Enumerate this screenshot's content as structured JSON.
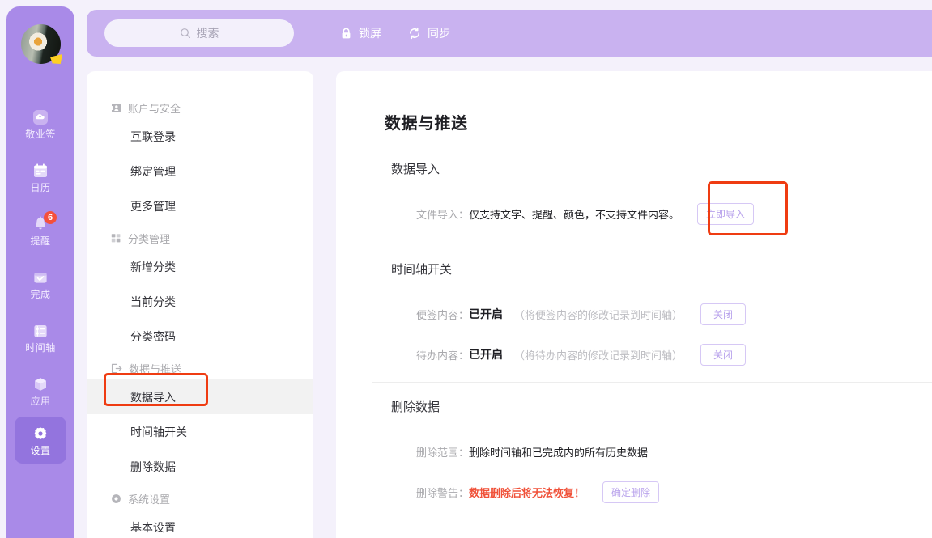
{
  "colors": {
    "rail_bg": "#a98ae8",
    "rail_active": "#9374de",
    "topbar_bg": "#c9b2f0",
    "page_bg": "#f4f1fb",
    "accent_purple": "#b9a3ec",
    "annotation_red": "#ef3c12",
    "danger_red": "#f0523a",
    "badge_red": "#f5503b"
  },
  "rail": {
    "avatar_name": "user-avatar",
    "items": [
      {
        "label": "敬业签",
        "icon": "note-cloud-icon",
        "active": false,
        "badge": ""
      },
      {
        "label": "日历",
        "icon": "calendar-icon",
        "active": false,
        "badge": ""
      },
      {
        "label": "提醒",
        "icon": "bell-icon",
        "active": false,
        "badge": "6"
      },
      {
        "label": "完成",
        "icon": "check-box-icon",
        "active": false,
        "badge": ""
      },
      {
        "label": "时间轴",
        "icon": "timeline-icon",
        "active": false,
        "badge": ""
      },
      {
        "label": "应用",
        "icon": "cube-icon",
        "active": false,
        "badge": ""
      },
      {
        "label": "设置",
        "icon": "gear-icon",
        "active": true,
        "badge": ""
      }
    ]
  },
  "topbar": {
    "search_placeholder": "搜索",
    "lock_label": "锁屏",
    "sync_label": "同步"
  },
  "nav": {
    "groups": [
      {
        "title": "账户与安全",
        "icon": "account-card-icon",
        "items": [
          {
            "label": "互联登录",
            "selected": false
          },
          {
            "label": "绑定管理",
            "selected": false
          },
          {
            "label": "更多管理",
            "selected": false
          }
        ]
      },
      {
        "title": "分类管理",
        "icon": "grid-icon",
        "items": [
          {
            "label": "新增分类",
            "selected": false
          },
          {
            "label": "当前分类",
            "selected": false
          },
          {
            "label": "分类密码",
            "selected": false
          }
        ]
      },
      {
        "title": "数据与推送",
        "icon": "export-icon",
        "items": [
          {
            "label": "数据导入",
            "selected": true
          },
          {
            "label": "时间轴开关",
            "selected": false
          },
          {
            "label": "删除数据",
            "selected": false
          }
        ]
      },
      {
        "title": "系统设置",
        "icon": "settings-circle-icon",
        "items": [
          {
            "label": "基本设置",
            "selected": false
          }
        ]
      }
    ]
  },
  "main": {
    "page_title": "数据与推送",
    "import_section": {
      "title": "数据导入",
      "row_label": "文件导入：",
      "row_value": "仅支持文字、提醒、颜色，不支持文件内容。",
      "button_label": "立即导入"
    },
    "timeline_section": {
      "title": "时间轴开关",
      "rows": [
        {
          "label": "便签内容：",
          "state": "已开启",
          "hint": "（将便签内容的修改记录到时间轴）",
          "button_label": "关闭"
        },
        {
          "label": "待办内容：",
          "state": "已开启",
          "hint": "（将待办内容的修改记录到时间轴）",
          "button_label": "关闭"
        }
      ]
    },
    "delete_section": {
      "title": "删除数据",
      "scope_label": "删除范围：",
      "scope_value": "删除时间轴和已完成内的所有历史数据",
      "warn_label": "删除警告：",
      "warn_value": "数据删除后将无法恢复！",
      "button_label": "确定删除"
    }
  }
}
